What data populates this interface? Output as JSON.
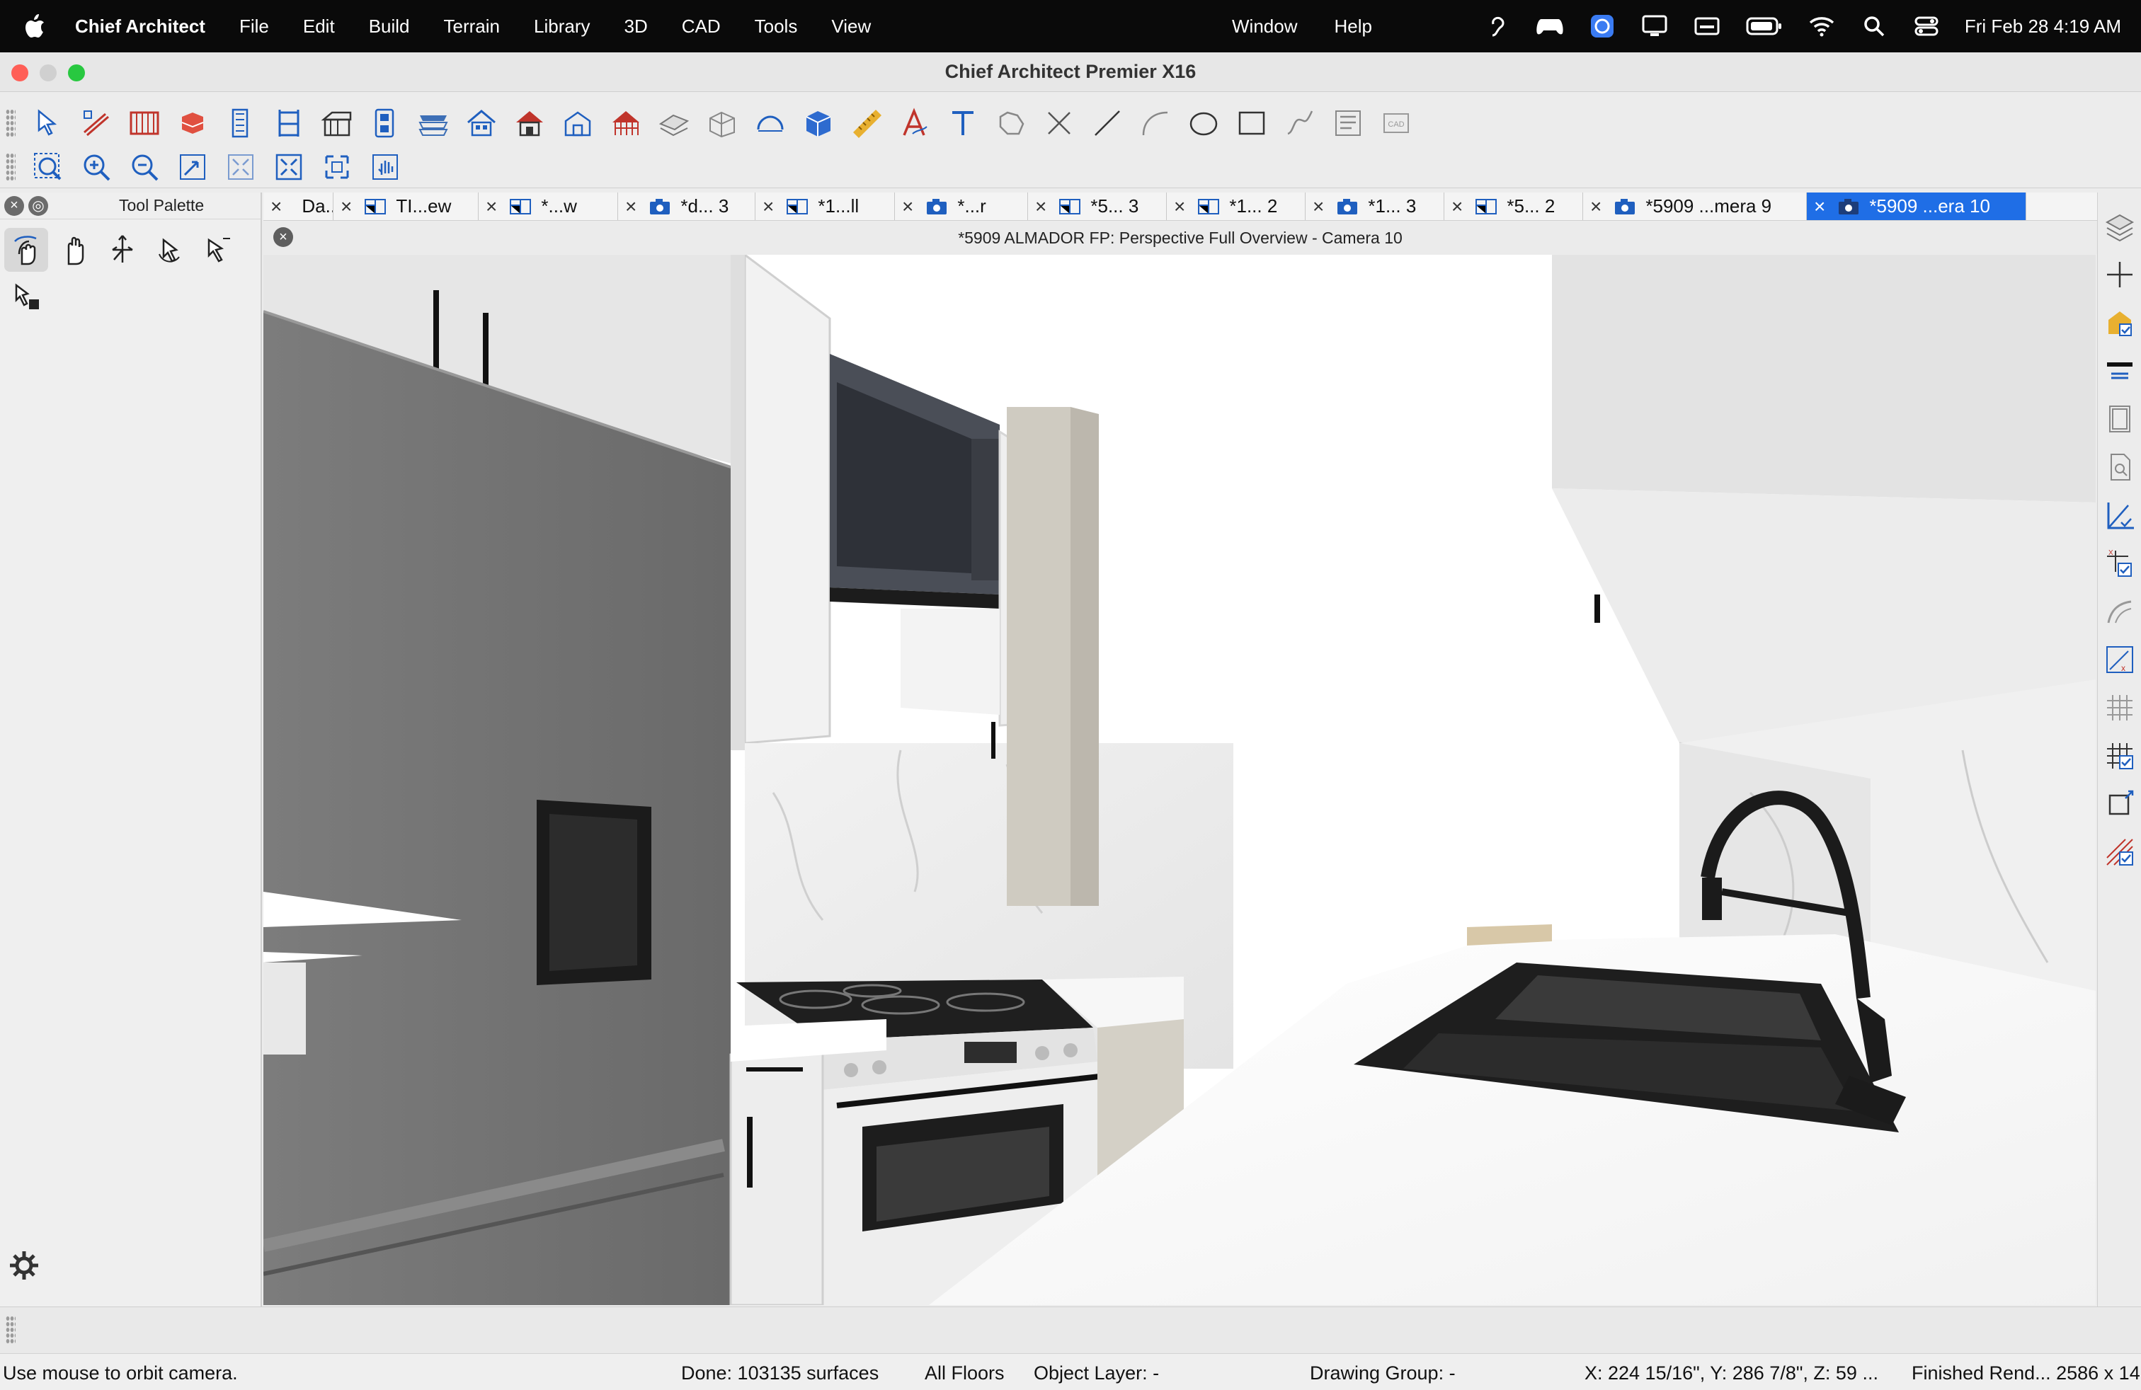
{
  "menubar": {
    "app_name": "Chief Architect",
    "items": [
      "File",
      "Edit",
      "Build",
      "Terrain",
      "Library",
      "3D",
      "CAD",
      "Tools",
      "View"
    ],
    "right_items": [
      "Window",
      "Help"
    ],
    "datetime": "Fri Feb 28  4:19 AM",
    "status_icons": [
      "accessibility-icon",
      "gamepad-icon",
      "app-badge-icon",
      "display-icon",
      "keyboard-icon",
      "battery-icon",
      "wifi-icon",
      "search-icon",
      "control-center-icon"
    ]
  },
  "window": {
    "title": "Chief Architect Premier X16",
    "traffic_colors": {
      "close": "#ff5f57",
      "minimize": "#d0d0d0",
      "zoom": "#28c840"
    }
  },
  "toolbar1": [
    "select-objects",
    "cabinet",
    "railing",
    "stairs",
    "door",
    "window",
    "roof",
    "dormer",
    "build-house",
    "house",
    "garage",
    "terrain",
    "fill",
    "rooms",
    "3d-box",
    "dimension",
    "text-style",
    "text",
    "ruler-polyline",
    "close-x",
    "line",
    "arc",
    "circle",
    "rectangle",
    "spline",
    "text-layout",
    "cad-block"
  ],
  "toolbar2": [
    "zoom-window",
    "zoom-in",
    "zoom-out",
    "undo-zoom",
    "fill-window",
    "fill-window-building",
    "fill-window-all",
    "pan"
  ],
  "palette": {
    "title": "Tool Palette",
    "tools": [
      "orbit-camera-tool",
      "pan-hand-tool",
      "move-camera-tool",
      "rotate-tool",
      "select-tool",
      "edit-tool"
    ]
  },
  "tabs": [
    {
      "label": "Da...rd",
      "icon": "elevation"
    },
    {
      "label": "TI...ew",
      "icon": "plan"
    },
    {
      "label": "*...w",
      "icon": "plan"
    },
    {
      "label": "*d... 3",
      "icon": "camera"
    },
    {
      "label": "*1...ll",
      "icon": "plan"
    },
    {
      "label": "*...r",
      "icon": "camera"
    },
    {
      "label": "*5... 3",
      "icon": "plan"
    },
    {
      "label": "*1... 2",
      "icon": "plan"
    },
    {
      "label": "*1... 3",
      "icon": "camera"
    },
    {
      "label": "*5... 2",
      "icon": "plan"
    },
    {
      "label": "*5909 ...mera 9",
      "icon": "camera"
    },
    {
      "label": "*5909 ...era 10",
      "icon": "camera",
      "active": true
    }
  ],
  "view": {
    "title": "*5909 ALMADOR FP: Perspective Full Overview - Camera 10"
  },
  "rightbar": [
    "layer-display",
    "add-icon",
    "material-painter",
    "floor-up",
    "wall-icon",
    "preview",
    "dimension-check",
    "coords-check",
    "curve-tool",
    "xy-tool",
    "grid-tool",
    "snap-grid",
    "transform",
    "slope-tool"
  ],
  "status": {
    "hint": "Use mouse to orbit camera.",
    "done": "Done:  103135 surfaces",
    "floors": "All Floors",
    "layer": "Object Layer: -",
    "group": "Drawing Group: -",
    "coords": "X: 224 15/16\", Y: 286 7/8\", Z: 59 ...",
    "render": "Finished Rend...  2586 x 14..."
  }
}
